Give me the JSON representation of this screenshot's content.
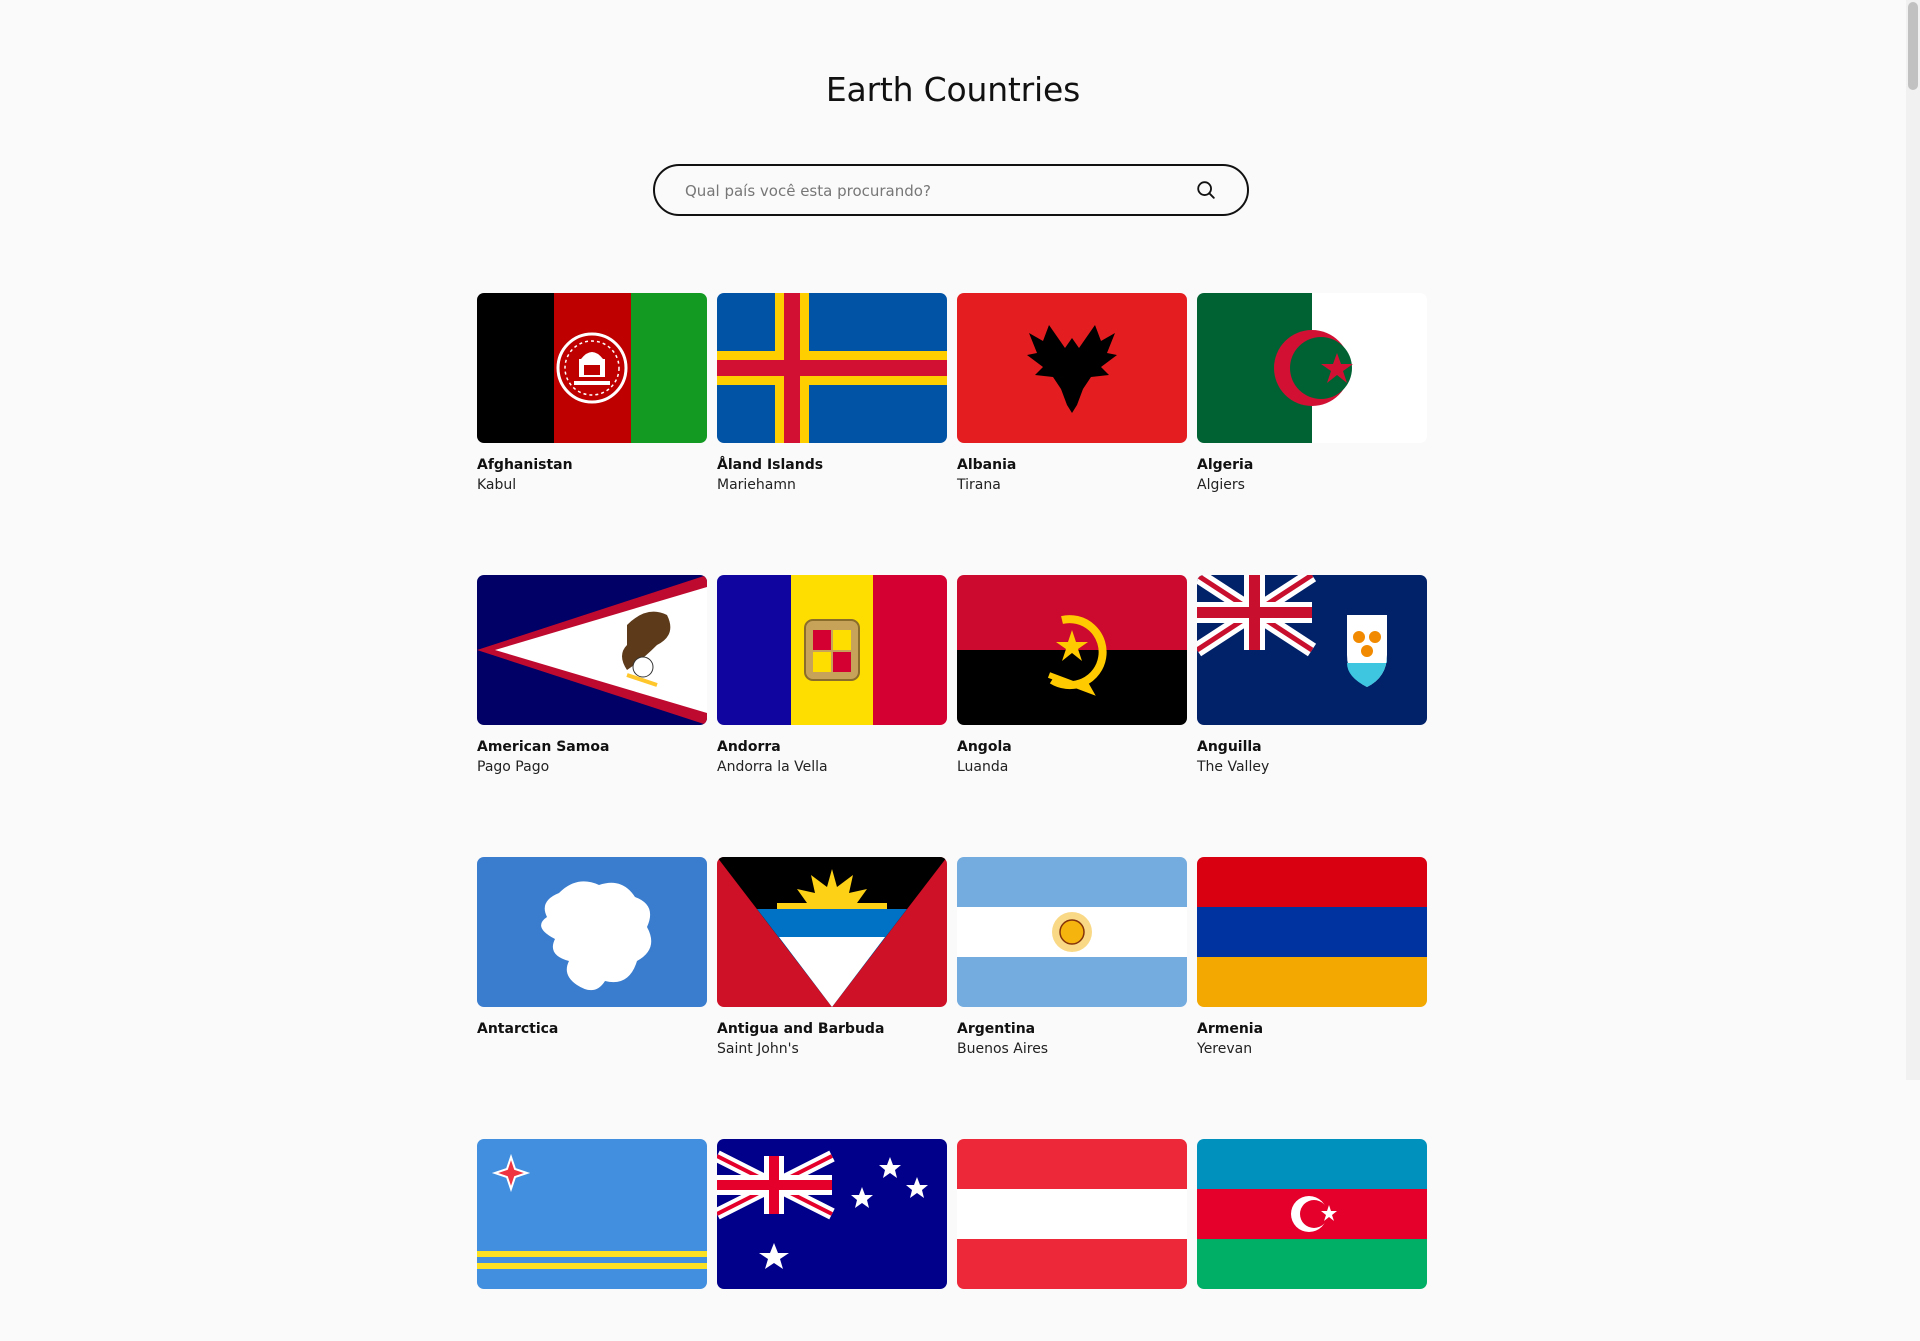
{
  "header": {
    "title": "Earth Countries"
  },
  "search": {
    "placeholder": "Qual país você esta procurando?",
    "value": "",
    "icon": "search-icon"
  },
  "countries": [
    {
      "name": "Afghanistan",
      "capital": "Kabul",
      "flag": "afghanistan-flag"
    },
    {
      "name": "Åland Islands",
      "capital": "Mariehamn",
      "flag": "aland-islands-flag"
    },
    {
      "name": "Albania",
      "capital": "Tirana",
      "flag": "albania-flag"
    },
    {
      "name": "Algeria",
      "capital": "Algiers",
      "flag": "algeria-flag"
    },
    {
      "name": "American Samoa",
      "capital": "Pago Pago",
      "flag": "american-samoa-flag"
    },
    {
      "name": "Andorra",
      "capital": "Andorra la Vella",
      "flag": "andorra-flag"
    },
    {
      "name": "Angola",
      "capital": "Luanda",
      "flag": "angola-flag"
    },
    {
      "name": "Anguilla",
      "capital": "The Valley",
      "flag": "anguilla-flag"
    },
    {
      "name": "Antarctica",
      "capital": "",
      "flag": "antarctica-flag"
    },
    {
      "name": "Antigua and Barbuda",
      "capital": "Saint John's",
      "flag": "antigua-and-barbuda-flag"
    },
    {
      "name": "Argentina",
      "capital": "Buenos Aires",
      "flag": "argentina-flag"
    },
    {
      "name": "Armenia",
      "capital": "Yerevan",
      "flag": "armenia-flag"
    },
    {
      "name": "",
      "capital": "",
      "flag": "aruba-flag"
    },
    {
      "name": "",
      "capital": "",
      "flag": "australia-flag"
    },
    {
      "name": "",
      "capital": "",
      "flag": "austria-flag"
    },
    {
      "name": "",
      "capital": "",
      "flag": "azerbaijan-flag"
    }
  ],
  "colors": {
    "background": "#fafafa",
    "text": "#111111",
    "border": "#111111"
  }
}
